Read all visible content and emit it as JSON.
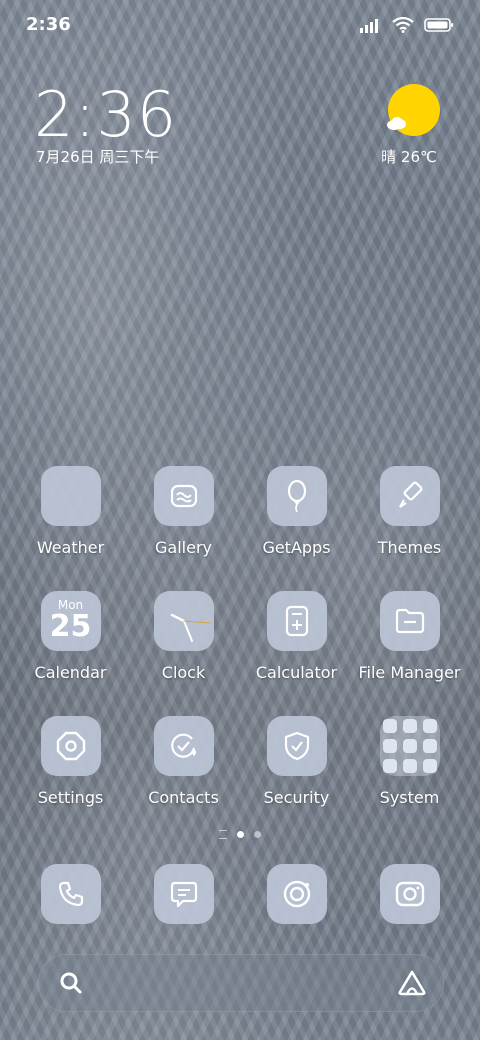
{
  "status_bar": {
    "time": "2:36"
  },
  "widget": {
    "time": "2:36",
    "date": "7月26日 周三下午",
    "weather": "晴 26℃"
  },
  "apps": [
    {
      "label": "Weather",
      "icon": "weather-icon"
    },
    {
      "label": "Gallery",
      "icon": "gallery-icon"
    },
    {
      "label": "GetApps",
      "icon": "balloon-icon"
    },
    {
      "label": "Themes",
      "icon": "brush-icon"
    },
    {
      "label": "Calendar",
      "icon": "calendar-icon",
      "month": "Mon",
      "day": "25"
    },
    {
      "label": "Clock",
      "icon": "clock-icon"
    },
    {
      "label": "Calculator",
      "icon": "calculator-icon"
    },
    {
      "label": "File Manager",
      "icon": "folder-icon"
    },
    {
      "label": "Settings",
      "icon": "gear-icon"
    },
    {
      "label": "Contacts",
      "icon": "contacts-icon"
    },
    {
      "label": "Security",
      "icon": "shield-icon"
    },
    {
      "label": "System",
      "icon": "app-folder-icon"
    }
  ],
  "dock": [
    {
      "name": "phone",
      "icon": "phone-icon"
    },
    {
      "name": "messages",
      "icon": "message-icon"
    },
    {
      "name": "browser",
      "icon": "browser-icon"
    },
    {
      "name": "camera",
      "icon": "camera-icon"
    }
  ],
  "pager": {
    "pages": 2,
    "active": 1
  },
  "colors": {
    "tile": "#bcc6d6",
    "sun": "#ffd400"
  }
}
